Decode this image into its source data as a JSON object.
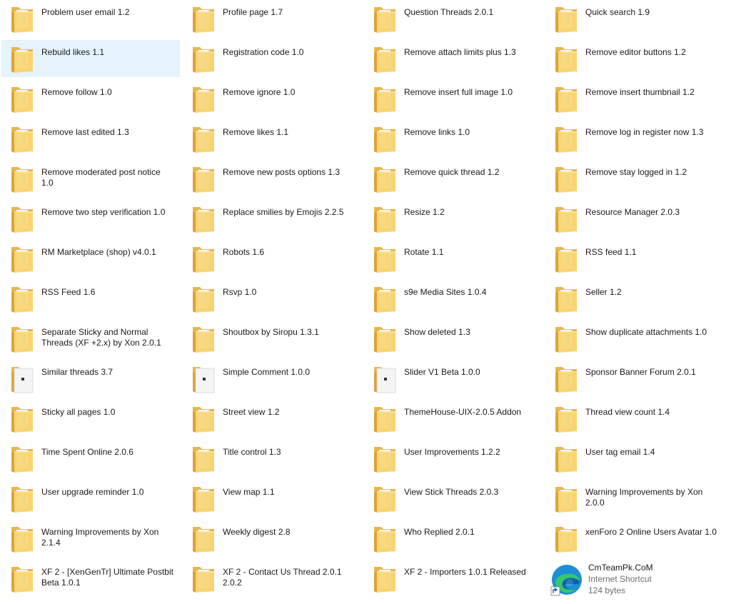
{
  "explorer": {
    "selected_index": 4,
    "items": [
      {
        "name": "Problem user email 1.2",
        "kind": "folder"
      },
      {
        "name": "Profile page 1.7",
        "kind": "folder"
      },
      {
        "name": "Question Threads 2.0.1",
        "kind": "folder"
      },
      {
        "name": "Quick search 1.9",
        "kind": "folder"
      },
      {
        "name": "Rebuild likes 1.1",
        "kind": "folder"
      },
      {
        "name": "Registration code 1.0",
        "kind": "folder"
      },
      {
        "name": "Remove attach limits plus 1.3",
        "kind": "folder"
      },
      {
        "name": "Remove editor buttons 1.2",
        "kind": "folder"
      },
      {
        "name": "Remove follow 1.0",
        "kind": "folder"
      },
      {
        "name": "Remove ignore 1.0",
        "kind": "folder"
      },
      {
        "name": "Remove insert full image 1.0",
        "kind": "folder"
      },
      {
        "name": "Remove insert thumbnail 1.2",
        "kind": "folder"
      },
      {
        "name": "Remove last edited 1.3",
        "kind": "folder"
      },
      {
        "name": "Remove likes 1.1",
        "kind": "folder"
      },
      {
        "name": "Remove links 1.0",
        "kind": "folder"
      },
      {
        "name": "Remove log in register now 1.3",
        "kind": "folder"
      },
      {
        "name": "Remove moderated post notice 1.0",
        "kind": "folder"
      },
      {
        "name": "Remove new posts options 1.3",
        "kind": "folder"
      },
      {
        "name": "Remove quick thread 1.2",
        "kind": "folder"
      },
      {
        "name": "Remove stay logged in 1.2",
        "kind": "folder"
      },
      {
        "name": "Remove two step verification 1.0",
        "kind": "folder"
      },
      {
        "name": "Replace smilies by Emojis 2.2.5",
        "kind": "folder"
      },
      {
        "name": "Resize 1.2",
        "kind": "folder"
      },
      {
        "name": "Resource Manager 2.0.3",
        "kind": "folder"
      },
      {
        "name": "RM Marketplace (shop) v4.0.1",
        "kind": "folder"
      },
      {
        "name": "Robots 1.6",
        "kind": "folder"
      },
      {
        "name": "Rotate 1.1",
        "kind": "folder"
      },
      {
        "name": "RSS feed 1.1",
        "kind": "folder"
      },
      {
        "name": "RSS Feed 1.6",
        "kind": "folder"
      },
      {
        "name": "Rsvp 1.0",
        "kind": "folder"
      },
      {
        "name": "s9e Media Sites 1.0.4",
        "kind": "folder"
      },
      {
        "name": "Seller 1.2",
        "kind": "folder"
      },
      {
        "name": "Separate Sticky and Normal Threads (XF +2.x) by Xon 2.0.1",
        "kind": "folder"
      },
      {
        "name": "Shoutbox by Siropu 1.3.1",
        "kind": "folder"
      },
      {
        "name": "Show deleted 1.3",
        "kind": "folder"
      },
      {
        "name": "Show duplicate attachments 1.0",
        "kind": "folder"
      },
      {
        "name": "Similar threads 3.7",
        "kind": "folder-empty"
      },
      {
        "name": "Simple Comment 1.0.0",
        "kind": "folder-empty"
      },
      {
        "name": "Slider V1 Beta 1.0.0",
        "kind": "folder-empty"
      },
      {
        "name": "Sponsor Banner Forum 2.0.1",
        "kind": "folder"
      },
      {
        "name": "Sticky all pages 1.0",
        "kind": "folder"
      },
      {
        "name": "Street view 1.2",
        "kind": "folder"
      },
      {
        "name": "ThemeHouse-UIX-2.0.5 Addon",
        "kind": "folder"
      },
      {
        "name": "Thread view count 1.4",
        "kind": "folder"
      },
      {
        "name": "Time Spent Online 2.0.6",
        "kind": "folder"
      },
      {
        "name": "Title control 1.3",
        "kind": "folder"
      },
      {
        "name": "User Improvements 1.2.2",
        "kind": "folder"
      },
      {
        "name": "User tag email 1.4",
        "kind": "folder"
      },
      {
        "name": "User upgrade reminder 1.0",
        "kind": "folder"
      },
      {
        "name": "View map 1.1",
        "kind": "folder"
      },
      {
        "name": "View Stick Threads 2.0.3",
        "kind": "folder"
      },
      {
        "name": "Warning Improvements by Xon 2.0.0",
        "kind": "folder"
      },
      {
        "name": "Warning Improvements by Xon 2.1.4",
        "kind": "folder"
      },
      {
        "name": "Weekly digest 2.8",
        "kind": "folder"
      },
      {
        "name": "Who Replied 2.0.1",
        "kind": "folder"
      },
      {
        "name": "xenForo 2 Online Users Avatar 1.0",
        "kind": "folder"
      },
      {
        "name": "XF 2 - [XenGenTr] Ultimate Postbit Beta 1.0.1",
        "kind": "folder"
      },
      {
        "name": "XF 2 - Contact Us Thread 2.0.1 2.0.2",
        "kind": "folder"
      },
      {
        "name": "XF 2 - Importers 1.0.1 Released",
        "kind": "folder"
      },
      {
        "name": "CmTeamPk.CoM",
        "kind": "shortcut",
        "type_label": "Internet Shortcut",
        "size_label": "124 bytes"
      }
    ]
  },
  "colors": {
    "folder_back": "#e8b64b",
    "folder_front": "#f9d675",
    "folder_edge": "#d9a43a",
    "selection": "#e5f3fd",
    "secondary_text": "#6d6d6d"
  }
}
